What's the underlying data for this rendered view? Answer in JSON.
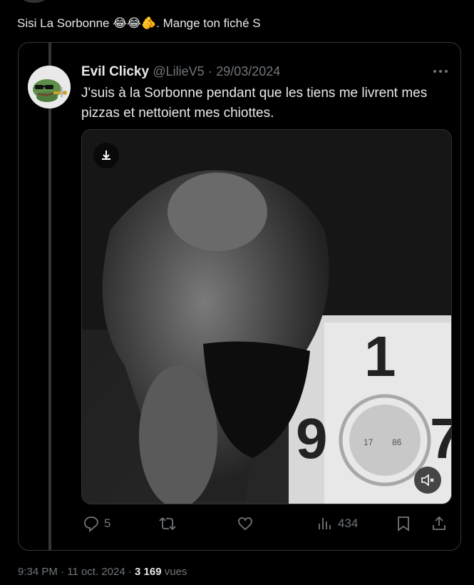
{
  "tweet": {
    "text": "Sisi La Sorbonne",
    "emojis": [
      "😂",
      "😂",
      "🫵"
    ],
    "text_end": ". Mange ton fiché S"
  },
  "quote": {
    "name": "Evil Clicky",
    "handle": "@LilieV5",
    "separator": "·",
    "date": "29/03/2024",
    "text": "J'suis à la Sorbonne pendant que les tiens me livrent mes pizzas et nettoient mes chiottes.",
    "more_icon": "more-horizontal-icon",
    "media": {
      "type": "video",
      "download_icon": "download-icon",
      "mute_icon": "speaker-muted-icon",
      "sign_digit_top": "1",
      "sign_digit_left": "9",
      "sign_digit_right": "7"
    },
    "actions": {
      "reply_count": "5",
      "retweet_count": "",
      "like_count": "",
      "views_count": "434"
    }
  },
  "footer": {
    "time": "9:34 PM",
    "separator": "·",
    "date": "11 oct. 2024",
    "views_count": "3 169",
    "views_label": "vues"
  },
  "colors": {
    "background": "#000000",
    "text_primary": "#e7e9ea",
    "text_secondary": "#71767b",
    "border": "#333639"
  }
}
